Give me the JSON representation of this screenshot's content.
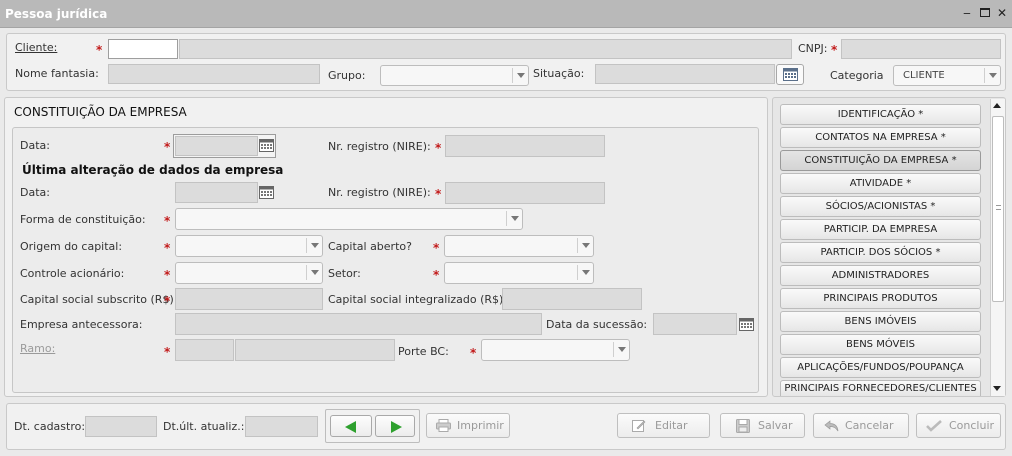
{
  "window": {
    "title": "Pessoa jurídica"
  },
  "header": {
    "cliente_label": "Cliente:",
    "cnpj_label": "CNPJ:",
    "nome_fantasia_label": "Nome fantasia:",
    "grupo_label": "Grupo:",
    "situacao_label": "Situação:",
    "categoria_label": "Categoria",
    "categoria_value": "CLIENTE"
  },
  "section": {
    "title": "CONSTITUIÇÃO DA EMPRESA",
    "data_label": "Data:",
    "nire_label": "Nr. registro (NIRE):",
    "ultima_title": "Última alteração de dados da empresa",
    "data2_label": "Data:",
    "nire2_label": "Nr. registro (NIRE):",
    "forma_label": "Forma de constituição:",
    "origem_label": "Origem do capital:",
    "capital_aberto_label": "Capital aberto?",
    "controle_label": "Controle acionário:",
    "setor_label": "Setor:",
    "capital_subscrito_label": "Capital social subscrito (R$):",
    "capital_integralizado_label": "Capital social integralizado (R$):",
    "antecessora_label": "Empresa antecessora:",
    "sucessao_label": "Data da sucessão:",
    "ramo_label": "Ramo:",
    "porte_label": "Porte BC:"
  },
  "nav": {
    "items": [
      "IDENTIFICAÇÃO *",
      "CONTATOS NA EMPRESA *",
      "CONSTITUIÇÃO DA EMPRESA *",
      "ATIVIDADE *",
      "SÓCIOS/ACIONISTAS *",
      "PARTICIP. DA EMPRESA",
      "PARTICIP. DOS SÓCIOS *",
      "ADMINISTRADORES",
      "PRINCIPAIS PRODUTOS",
      "BENS IMÓVEIS",
      "BENS MÓVEIS",
      "APLICAÇÕES/FUNDOS/POUPANÇA",
      "PRINCIPAIS FORNECEDORES/CLIENTES"
    ],
    "active_index": 2
  },
  "footer": {
    "dt_cadastro_label": "Dt. cadastro:",
    "dt_atualiz_label": "Dt.últ. atualiz.:",
    "imprimir": "Imprimir",
    "editar": "Editar",
    "salvar": "Salvar",
    "cancelar": "Cancelar",
    "concluir": "Concluir"
  },
  "colors": {
    "required": "#c21a1a",
    "nav_arrow": "#2ea02e"
  }
}
